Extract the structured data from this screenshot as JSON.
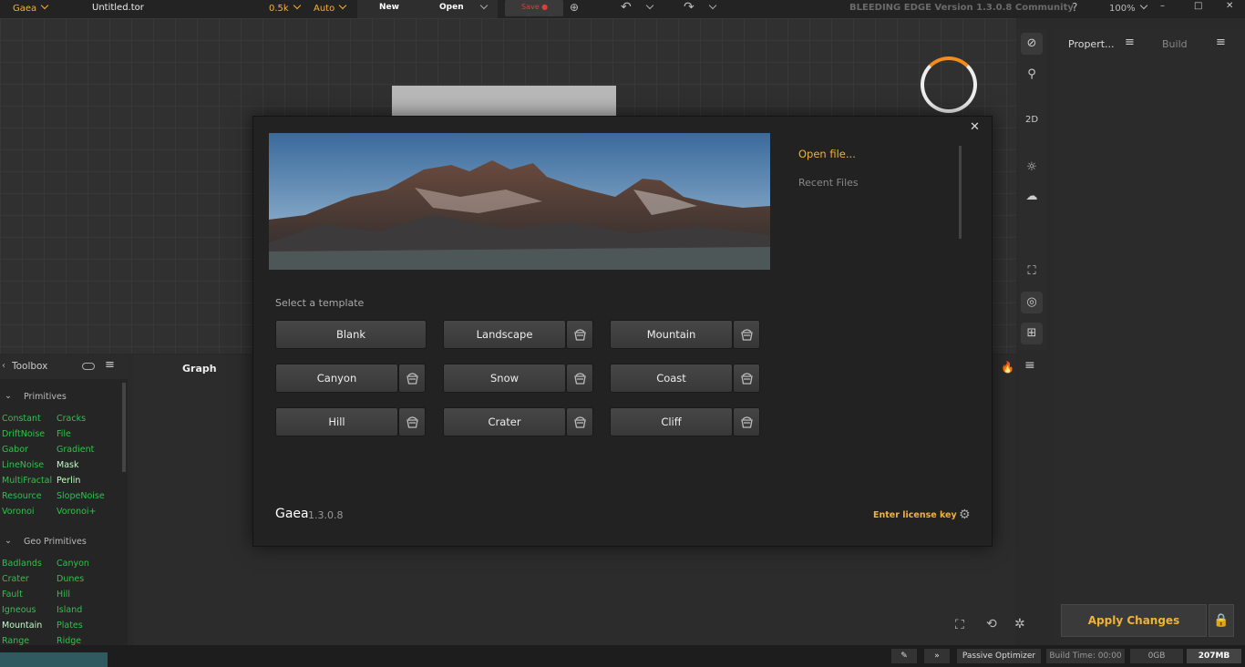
{
  "app": {
    "name": "Gaea",
    "file_name": "Untitled.tor",
    "resolution": "0.5k",
    "build_mode": "Auto",
    "version_banner": "BLEEDING EDGE Version 1.3.0.8 Community",
    "zoom": "100%"
  },
  "toolbar": {
    "new_label": "New",
    "open_label": "Open",
    "save_label": "Save ●"
  },
  "viewport": {
    "btn_2d": "2D"
  },
  "right_panel": {
    "properties_tab": "Propert...",
    "build_tab": "Build",
    "apply_label": "Apply Changes"
  },
  "toolbox": {
    "title": "Toolbox",
    "categories": [
      {
        "name": "Primitives",
        "nodes": [
          [
            "Constant",
            "Cracks"
          ],
          [
            "DriftNoise",
            "File"
          ],
          [
            "Gabor",
            "Gradient"
          ],
          [
            "LineNoise",
            "Mask"
          ],
          [
            "MultiFractal",
            "Perlin"
          ],
          [
            "Resource",
            "SlopeNoise"
          ],
          [
            "Voronoi",
            "Voronoi+"
          ]
        ]
      },
      {
        "name": "Geo Primitives",
        "nodes": [
          [
            "Badlands",
            "Canyon"
          ],
          [
            "Crater",
            "Dunes"
          ],
          [
            "Fault",
            "Hill"
          ],
          [
            "Igneous",
            "Island"
          ],
          [
            "Mountain",
            "Plates"
          ],
          [
            "Range",
            "Ridge"
          ]
        ]
      }
    ]
  },
  "graph": {
    "tab_label": "Graph"
  },
  "statusbar": {
    "optimizer": "Passive Optimizer",
    "build_time": "Build Time: 00:00",
    "disk": "0GB",
    "memory": "207MB"
  },
  "modal": {
    "open_file": "Open file...",
    "recent_files": "Recent Files",
    "select_template": "Select a template",
    "templates": [
      "Blank",
      "Landscape",
      "Mountain",
      "Canyon",
      "Snow",
      "Coast",
      "Hill",
      "Crater",
      "Cliff"
    ],
    "brand": "Gaea",
    "version": "1.3.0.8",
    "license_link": "Enter license key"
  },
  "colors": {
    "accent": "#f2b233",
    "node_green": "#2fc24a",
    "brand_orange": "#f28c1b"
  }
}
